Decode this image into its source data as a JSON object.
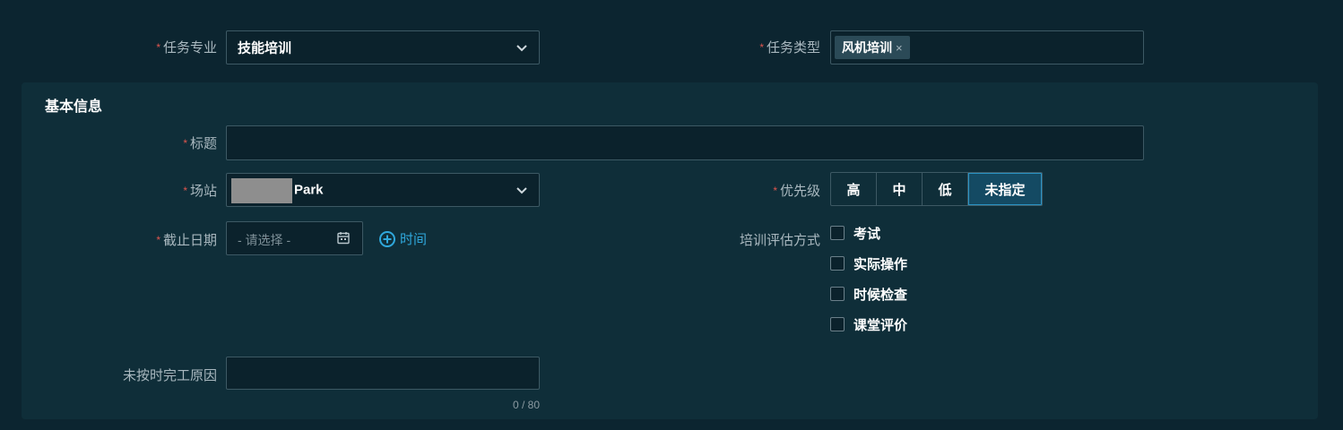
{
  "top": {
    "task_specialty": {
      "label": "任务专业",
      "value": "技能培训"
    },
    "task_type": {
      "label": "任务类型",
      "tag": "风机培训",
      "tag_remove": "×"
    }
  },
  "basic_info": {
    "section_title": "基本信息",
    "title_field": {
      "label": "标题",
      "value": ""
    },
    "site": {
      "label": "场站",
      "value": "Park"
    },
    "priority": {
      "label": "优先级",
      "options": [
        "高",
        "中",
        "低",
        "未指定"
      ],
      "selected": "未指定"
    },
    "deadline": {
      "label": "截止日期",
      "placeholder": "- 请选择 -",
      "add_time": "时间"
    },
    "evaluation": {
      "label": "培训评估方式",
      "options": [
        "考试",
        "实际操作",
        "时候检查",
        "课堂评价"
      ]
    },
    "late_reason": {
      "label": "未按时完工原因",
      "value": "",
      "counter": "0 / 80"
    }
  },
  "colors": {
    "background": "#0c2530",
    "panel": "#0f2e39",
    "border": "#3d5964",
    "required": "#e0564f",
    "accent": "#2fa8dc"
  }
}
